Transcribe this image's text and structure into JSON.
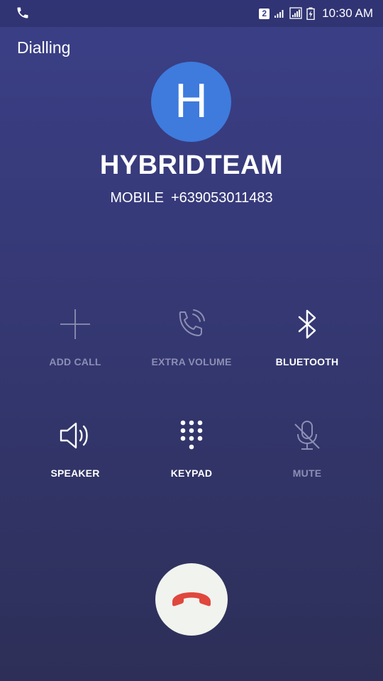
{
  "status_bar": {
    "sim_slot": "2",
    "time": "10:30 AM",
    "icons": [
      "call-ongoing-icon",
      "sim-badge",
      "signal-icon",
      "signal-icon",
      "battery-charging-icon"
    ]
  },
  "call": {
    "state": "Dialling",
    "avatar_letter": "H",
    "contact_name": "HYBRIDTEAM",
    "number_type": "MOBILE",
    "number": "+639053011483"
  },
  "controls": [
    {
      "label": "ADD CALL",
      "icon": "plus-icon",
      "enabled": false
    },
    {
      "label": "EXTRA VOLUME",
      "icon": "phone-volume-icon",
      "enabled": false
    },
    {
      "label": "BLUETOOTH",
      "icon": "bluetooth-icon",
      "enabled": true
    },
    {
      "label": "SPEAKER",
      "icon": "speaker-icon",
      "enabled": true
    },
    {
      "label": "KEYPAD",
      "icon": "keypad-icon",
      "enabled": true
    },
    {
      "label": "MUTE",
      "icon": "mic-off-icon",
      "enabled": false
    }
  ],
  "end_call": {
    "icon": "end-call-icon"
  },
  "colors": {
    "background_top": "#3b3f87",
    "background_bottom": "#2d2f58",
    "avatar": "#3e7bdd",
    "end_call_bg": "#f1f3ee",
    "end_call_icon": "#e0473d",
    "disabled_text": "#8c8fb3"
  }
}
